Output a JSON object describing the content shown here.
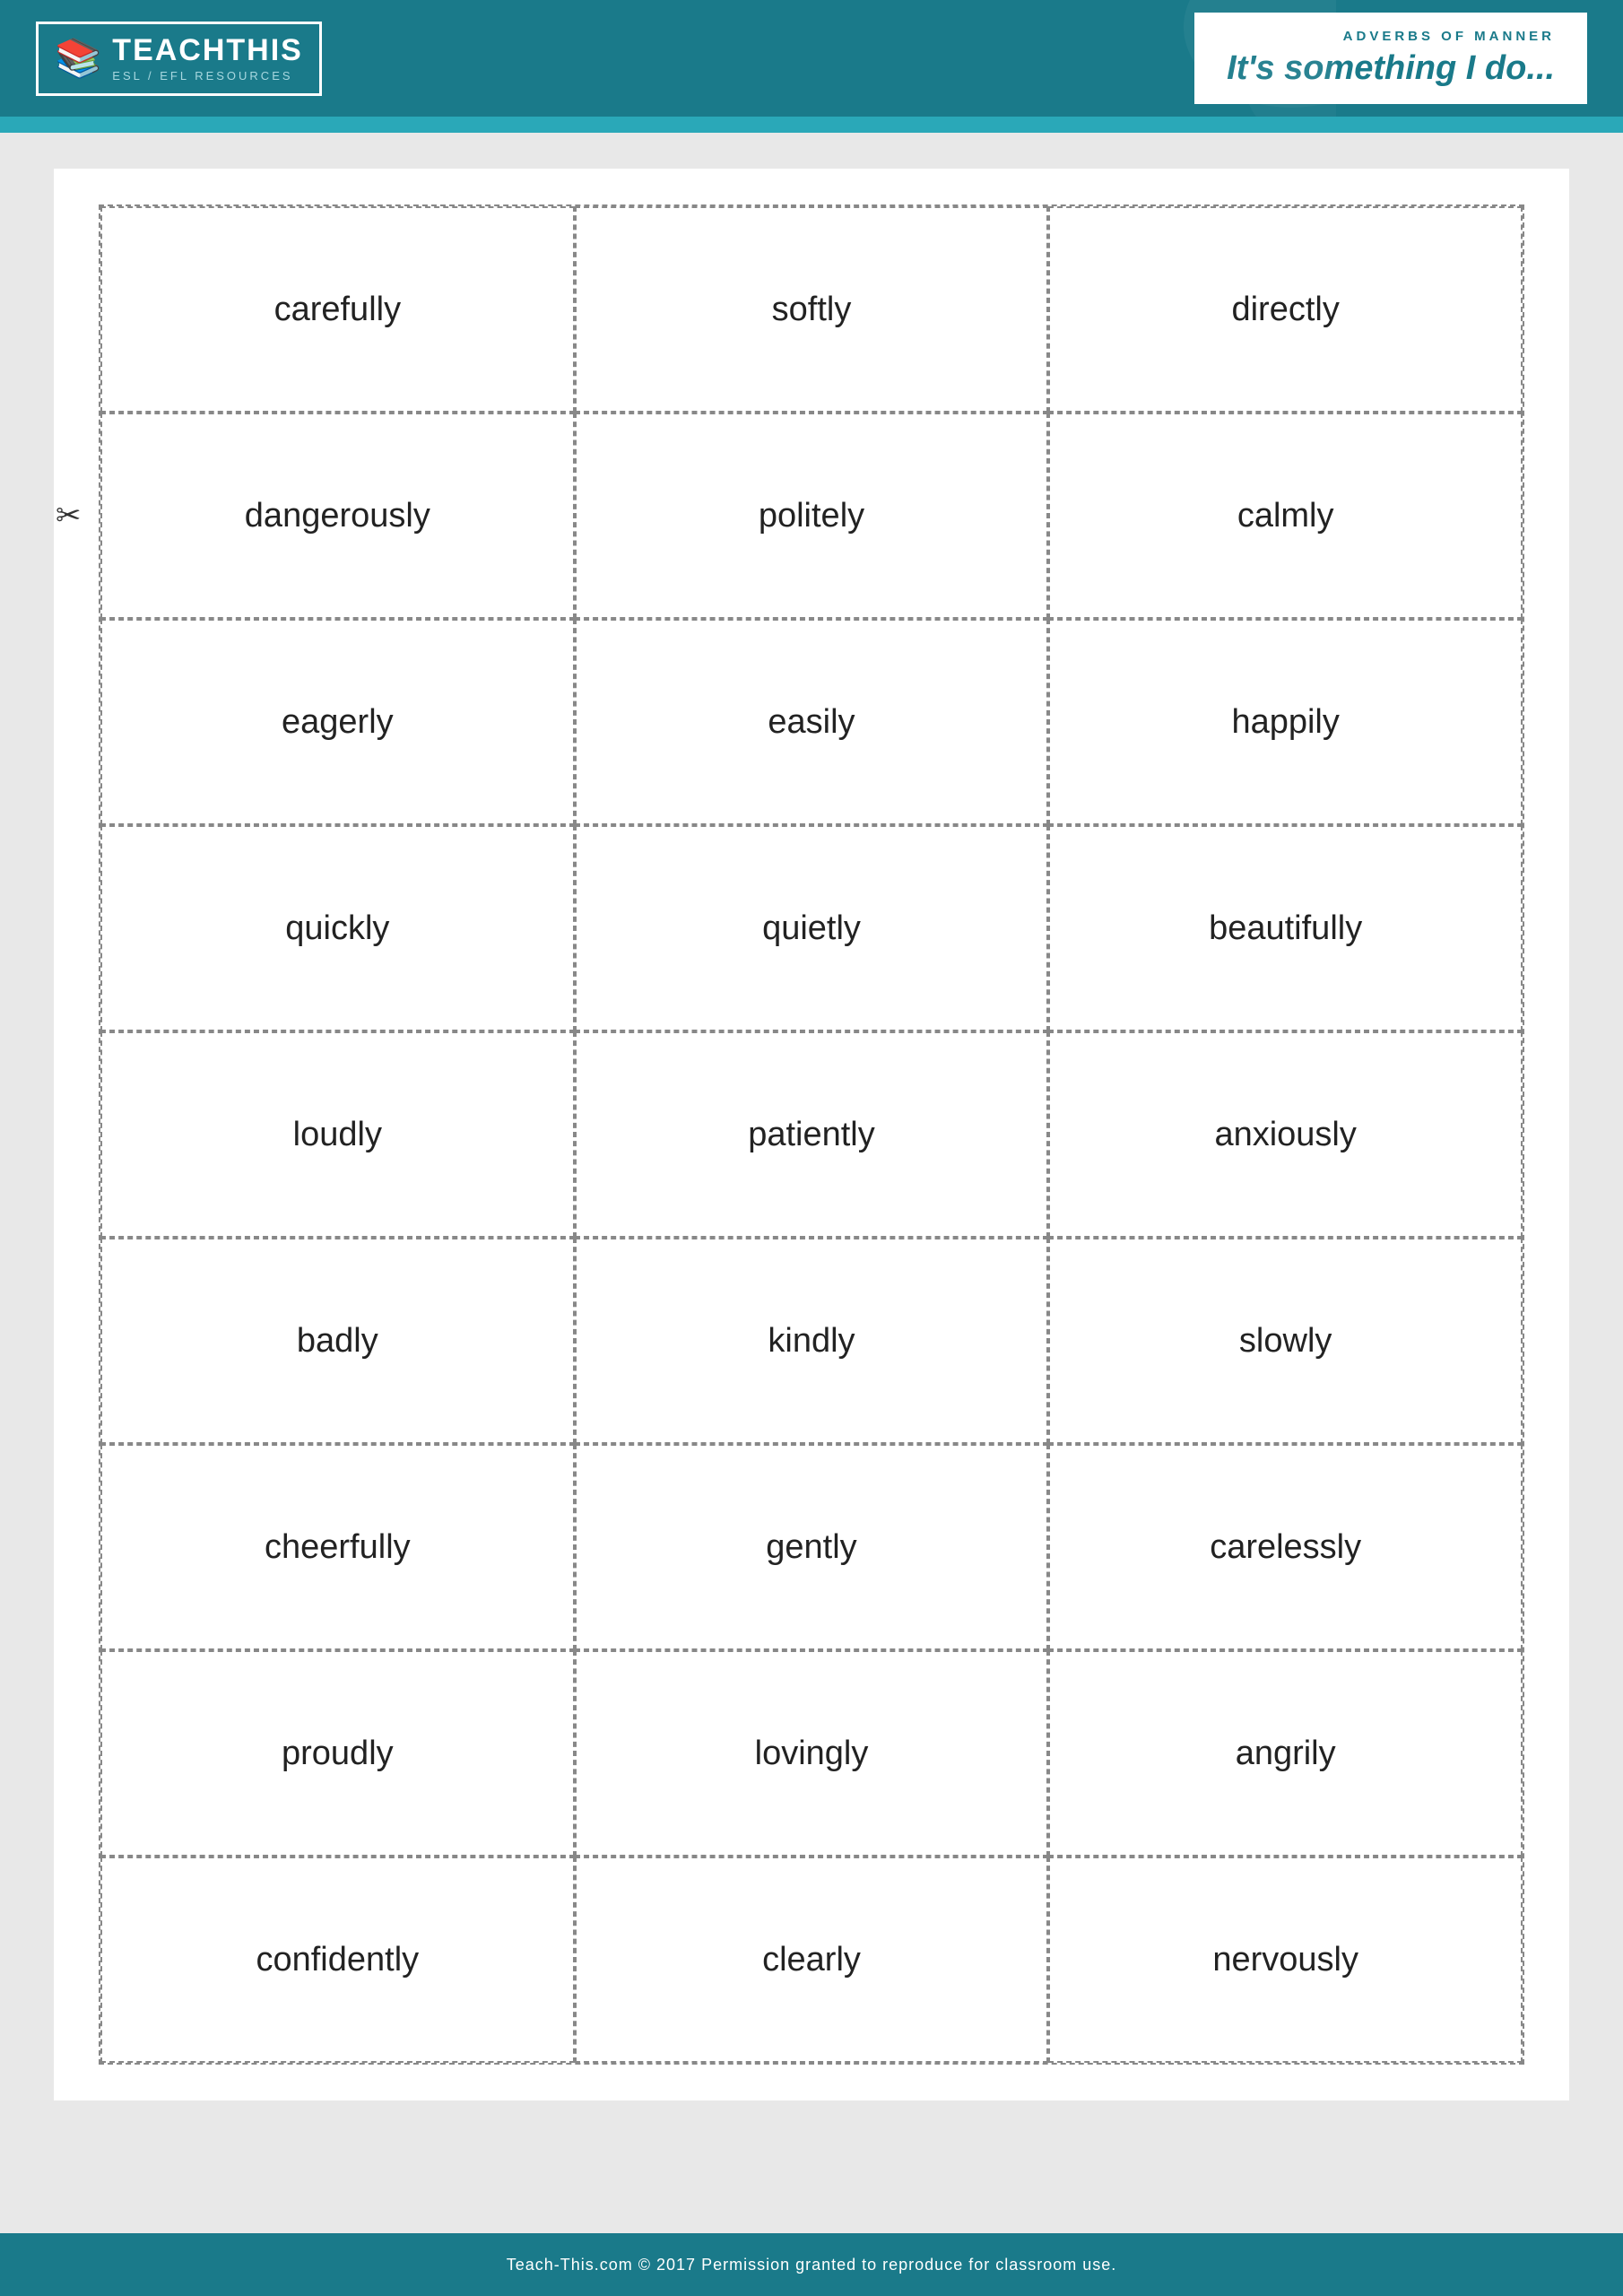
{
  "header": {
    "logo_main": "TEACHTHIS",
    "logo_sub": "ESL / EFL RESOURCES",
    "subtitle": "ADVERBS OF MANNER",
    "title": "It's something I do..."
  },
  "footer": {
    "text": "Teach-This.com © 2017 Permission granted to reproduce for classroom use."
  },
  "grid": {
    "rows": [
      [
        "carefully",
        "softly",
        "directly"
      ],
      [
        "dangerously",
        "politely",
        "calmly"
      ],
      [
        "eagerly",
        "easily",
        "happily"
      ],
      [
        "quickly",
        "quietly",
        "beautifully"
      ],
      [
        "loudly",
        "patiently",
        "anxiously"
      ],
      [
        "badly",
        "kindly",
        "slowly"
      ],
      [
        "cheerfully",
        "gently",
        "carelessly"
      ],
      [
        "proudly",
        "lovingly",
        "angrily"
      ],
      [
        "confidently",
        "clearly",
        "nervously"
      ]
    ],
    "scissors_row": 1
  }
}
